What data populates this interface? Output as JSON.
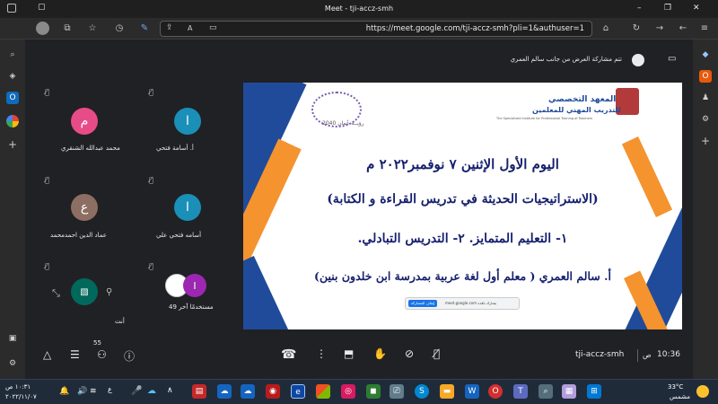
{
  "window": {
    "title": "Meet - tji-accz-smh",
    "controls": [
      "–",
      "❐",
      "✕"
    ]
  },
  "browser": {
    "url": "https://meet.google.com/tji-accz-smh?pli=1&authuser=1"
  },
  "meet": {
    "presenting_notice": "تتم مشاركة العرض من جانب سالم العمري",
    "participants": [
      {
        "initial": "م",
        "name": "محمد عبدالله الشنقري",
        "color": "#e84c88"
      },
      {
        "initial": "ا",
        "name": "أ. أسامة فتحي",
        "color": "#1a8fb8"
      },
      {
        "initial": "ع",
        "name": "عماد الدين احمدمحمد",
        "color": "#8d6e63"
      },
      {
        "initial": "ا",
        "name": "أسامه فتحي علي",
        "color": "#1a8fb8"
      },
      {
        "initial": "I",
        "name": "49 مستخدمًا آخر",
        "color": "#9c27b0"
      },
      {
        "initial": "",
        "name": "أنت",
        "color": "#00695c"
      }
    ],
    "meeting_code": "tji-accz-smh",
    "time": "10:36",
    "ampm": "ص",
    "people_count": "55"
  },
  "slide": {
    "institute_ar_1": "المعهد التخصصي",
    "institute_ar_2": "للتدريب المهني للمعلمين",
    "institute_en": "The Specialized Institute for Professional Training of Teachers",
    "vision": "رؤيــة عُمان 2040",
    "line1": "اليوم الأول الإثنين ٧ نوفمبر٢٠٢٢ م",
    "line2": "(الاستراتيجيات الحديثة في تدريس القراءة و الكتابة)",
    "line3": "١- التعليم المتمايز.   ٢- التدريس التبادلي.",
    "line4": "أ. سالم العمري ( معلم أول لغة عربية بمدرسة ابن خلدون بنين)",
    "share_bar_text": "meet.google.com يشارك نافذة",
    "share_bar_button": "إيقاف المشاركة"
  },
  "taskbar": {
    "clock_time": "١٠:٣١ ص",
    "clock_date": "٢٠٢٢/١١/٠٧",
    "lang": "ع",
    "weather_temp": "33°C",
    "weather_text": "مشمس"
  }
}
